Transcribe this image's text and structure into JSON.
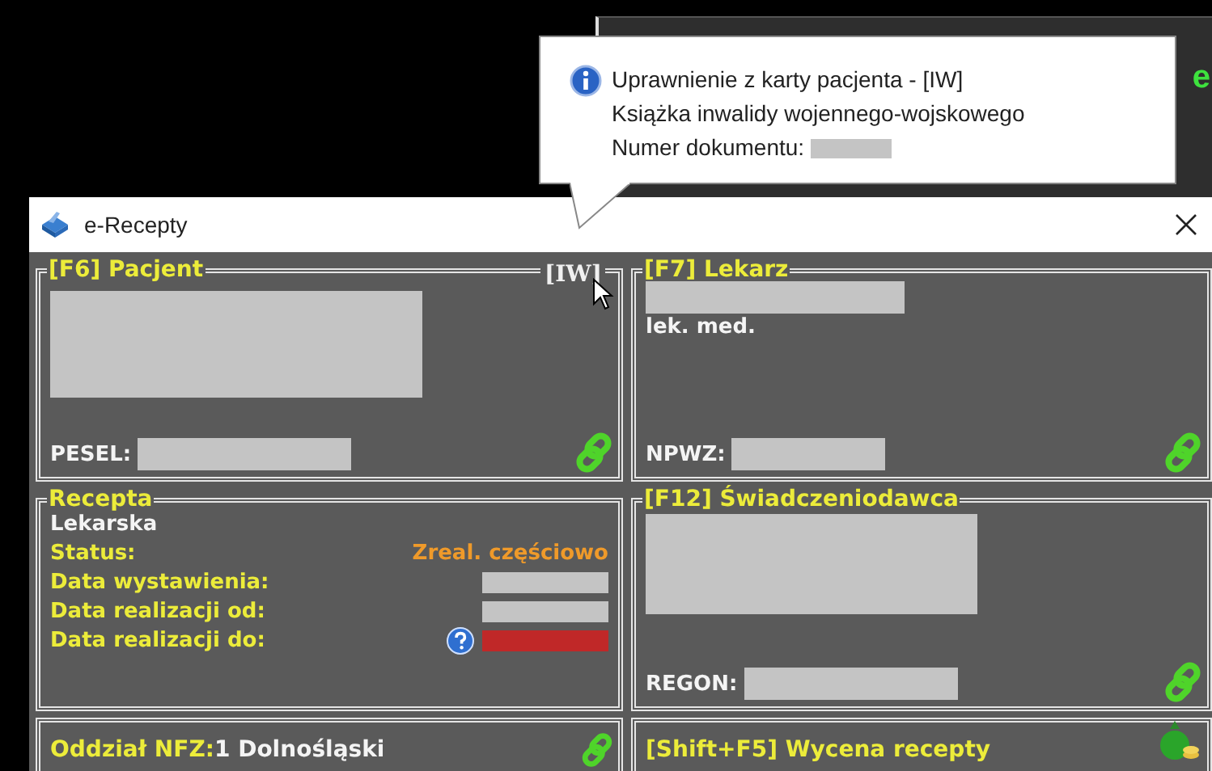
{
  "background": {
    "text": "e"
  },
  "tooltip": {
    "lines": [
      "Uprawnienie z karty pacjenta - [IW]",
      "Książka inwalidy wojennego-wojskowego"
    ],
    "doc_label": "Numer dokumentu:"
  },
  "window": {
    "title": "e-Recepty"
  },
  "patient": {
    "title": "[F6] Pacjent",
    "tag": "[IW]",
    "id_label": "PESEL:"
  },
  "doctor": {
    "title": "[F7] Lekarz",
    "degree": "lek. med.",
    "id_label": "NPWZ:"
  },
  "prescription": {
    "title": "Recepta",
    "type": "Lekarska",
    "rows": [
      {
        "label": "Status:",
        "kind": "status",
        "value": "Zreal. częściowo"
      },
      {
        "label": "Data wystawienia:",
        "kind": "date"
      },
      {
        "label": "Data realizacji od:",
        "kind": "date"
      },
      {
        "label": "Data realizacji do:",
        "kind": "date_warning"
      }
    ]
  },
  "provider": {
    "title": "[F12] Świadczeniodawca",
    "id_label": "REGON:"
  },
  "nfz": {
    "label": "Oddział NFZ:",
    "value": "1 Dolnośląski"
  },
  "pricing": {
    "label": "[Shift+F5] Wycena recepty"
  }
}
